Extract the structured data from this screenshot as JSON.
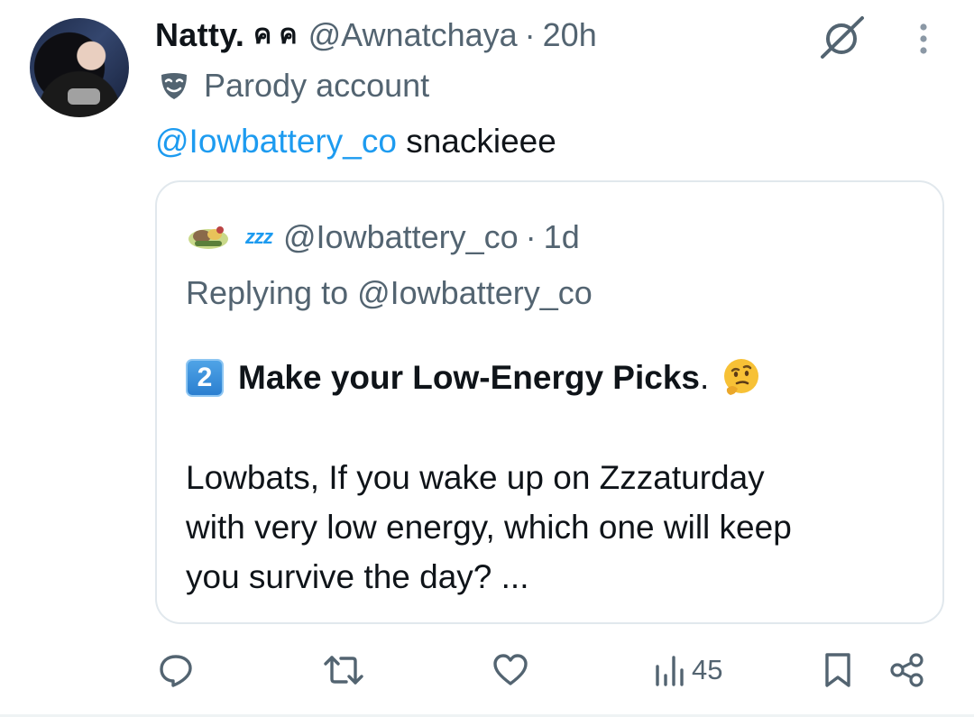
{
  "post": {
    "author": {
      "display_name": "Natty.",
      "name_glyphs": "ค ค",
      "handle": "@Awnatchaya",
      "separator": "·",
      "time": "20h",
      "label": "Parody account"
    },
    "text": {
      "mention": "@Iowbattery_co",
      "body": " snackieee"
    }
  },
  "quoted": {
    "zzz": "zzz",
    "handle": "@Iowbattery_co",
    "separator": "·",
    "time": "1d",
    "replying_to": "Replying to @Iowbattery_co",
    "keycap": "2",
    "headline": "Make your Low-Energy Picks",
    "headline_tail": ".",
    "body_lines": [
      "Lowbats, If you wake up on Zzzaturday",
      "with very low energy, which one will keep",
      "you survive the day? ..."
    ]
  },
  "actions": {
    "views_count": "45"
  },
  "colors": {
    "accent": "#1d9bf0",
    "muted": "#536471",
    "text": "#0f1419",
    "border": "#e1e8ed"
  },
  "icons": [
    "grok-icon",
    "more-icon",
    "parody-mask-icon",
    "thinking-face-icon",
    "reply-icon",
    "repost-icon",
    "like-icon",
    "views-icon",
    "bookmark-icon",
    "share-icon"
  ]
}
